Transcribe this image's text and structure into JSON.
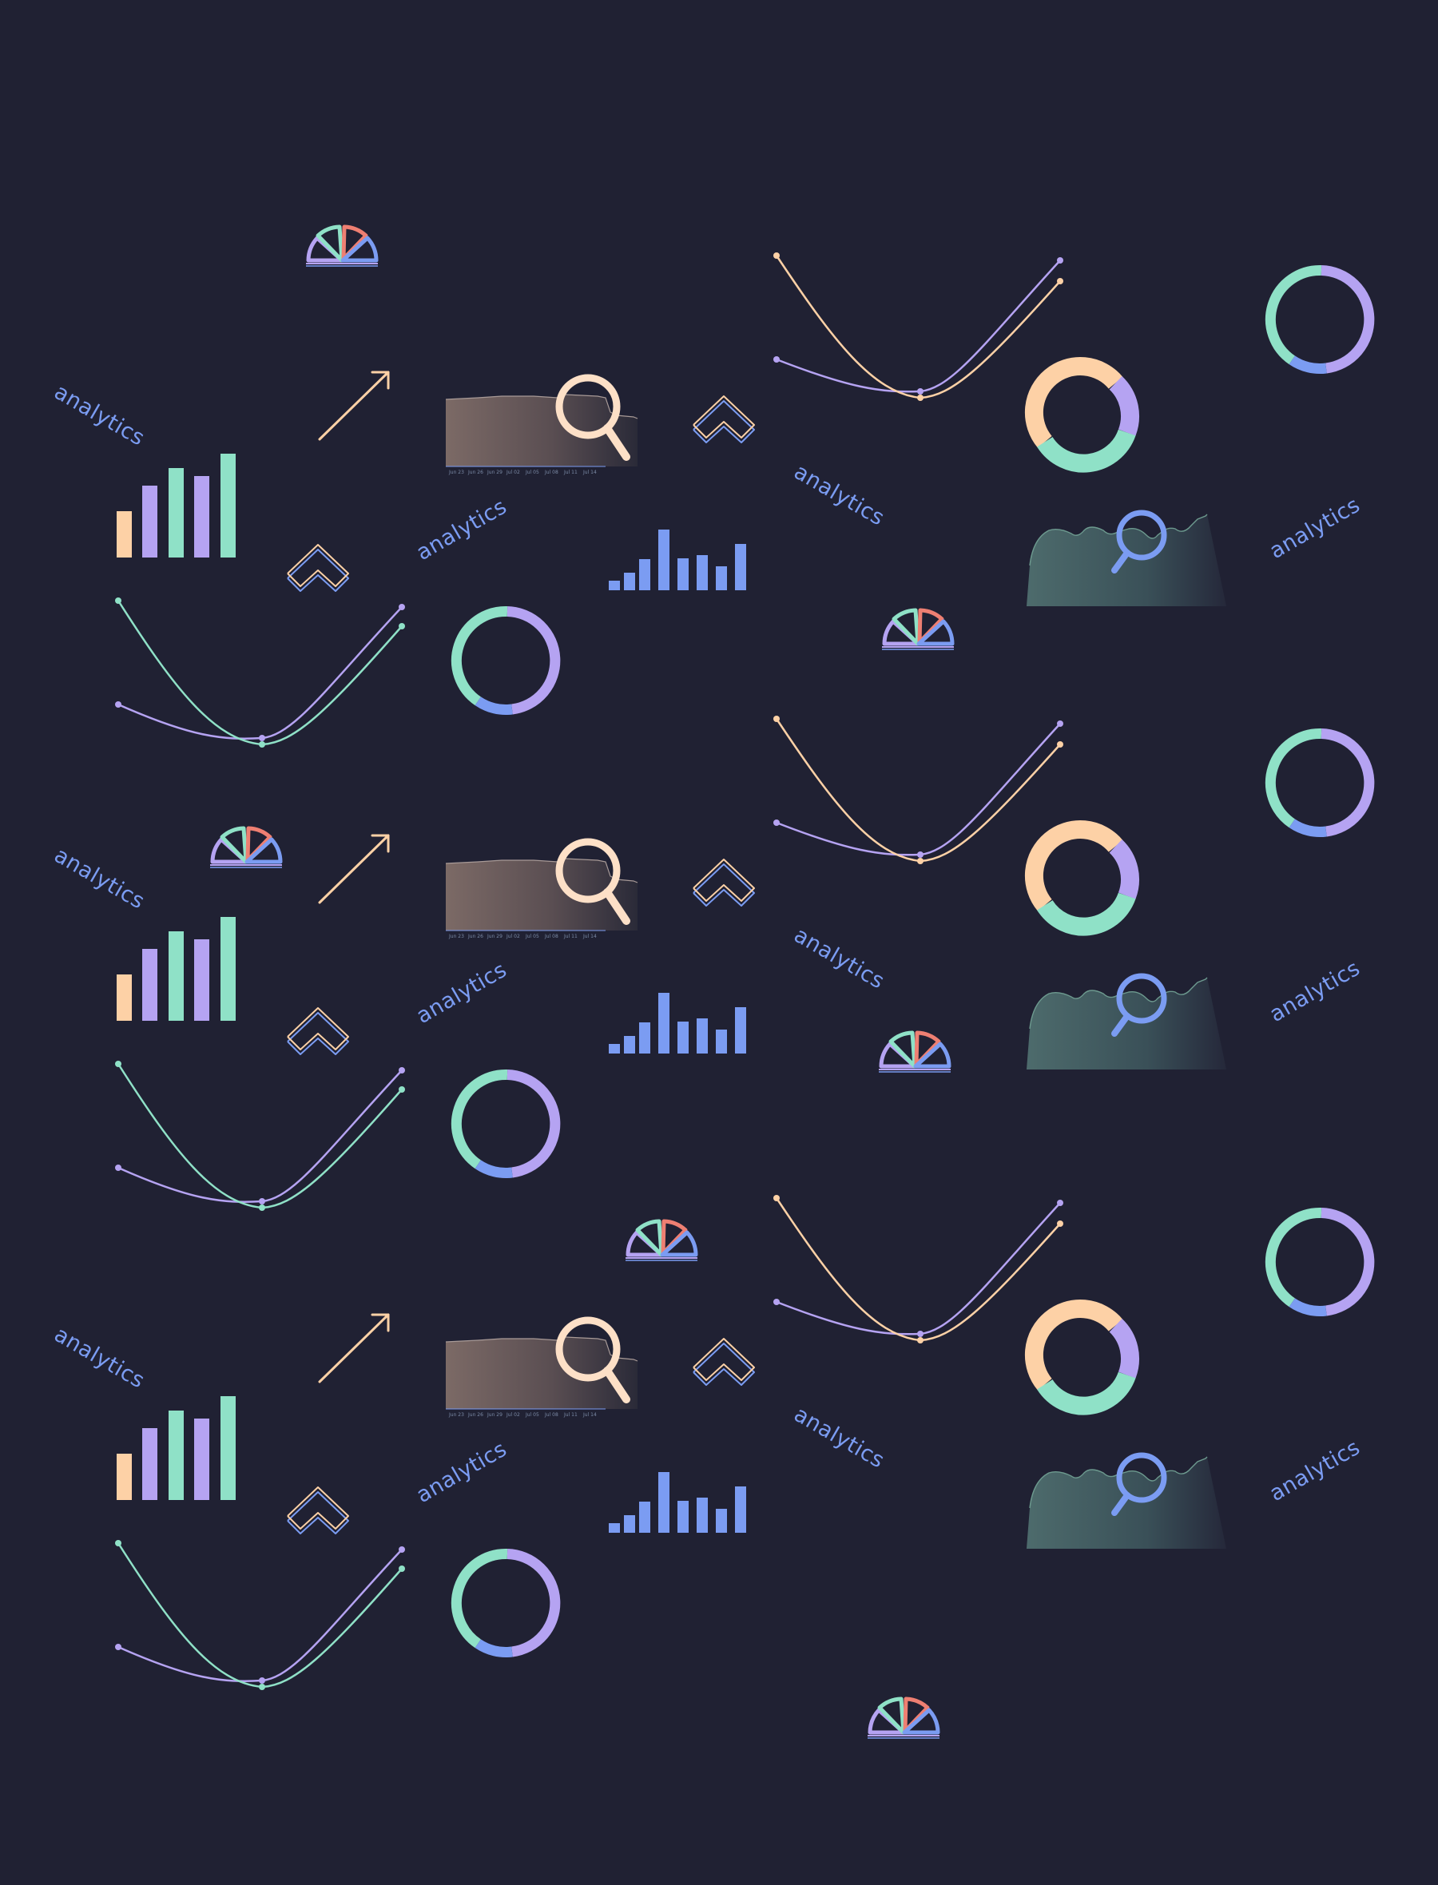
{
  "pattern": {
    "background": "#202133",
    "palette": {
      "peach": "#fdd1a6",
      "lavender": "#b5a3f2",
      "mint": "#8fe1c7",
      "blue": "#7b9cf2",
      "coral": "#ee7f72"
    },
    "label_text": "analytics",
    "area_tick_labels": [
      "Jun 23",
      "Jun 26",
      "Jun 29",
      "Jul 02",
      "Jul 05",
      "Jul 08",
      "Jul 11",
      "Jul 14"
    ],
    "icons": [
      "pie-slices-icon",
      "trend-arrow-icon",
      "area-chart-search-icon",
      "chevron-up-icon",
      "parabola-curves-icon",
      "donut-ring-icon",
      "donut-chart-icon",
      "bar-chart-icon",
      "mini-bar-chart-icon",
      "analytics-label"
    ]
  }
}
